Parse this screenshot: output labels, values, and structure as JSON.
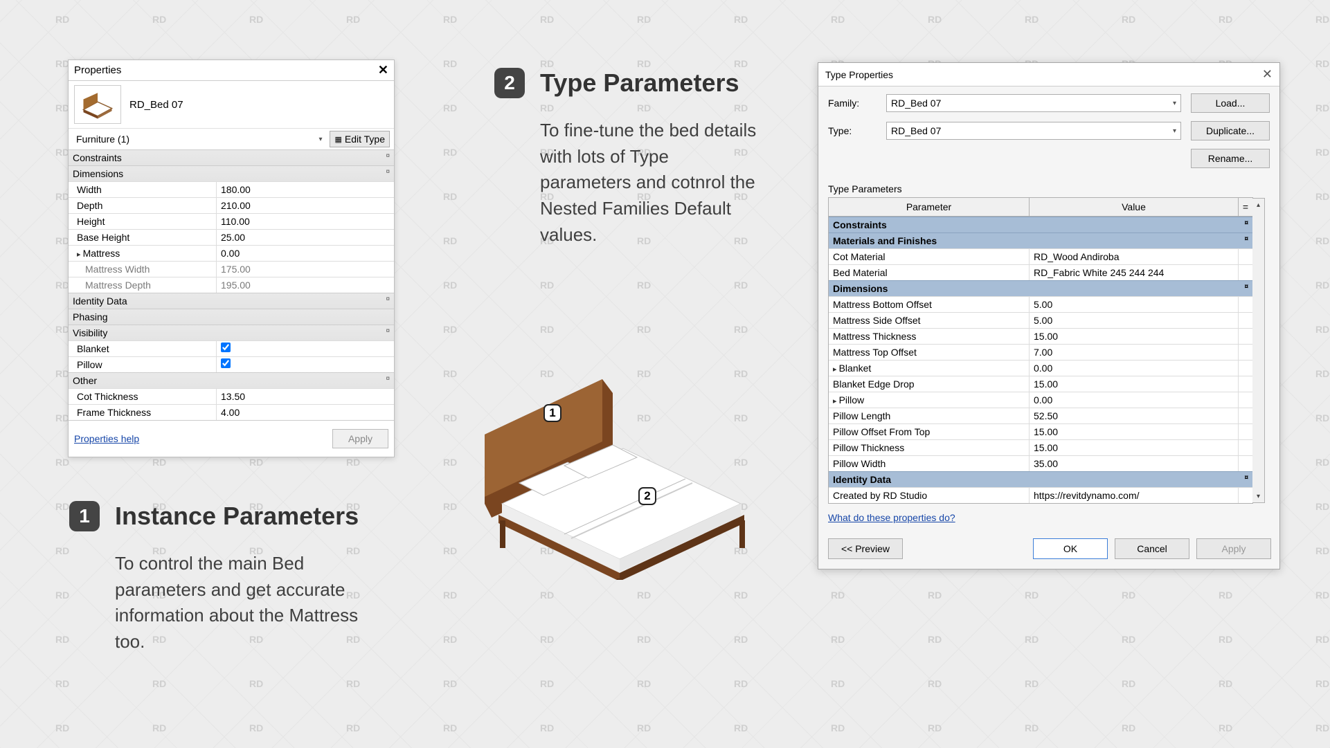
{
  "props": {
    "title": "Properties",
    "item_name": "RD_Bed 07",
    "filter": "Furniture (1)",
    "edit_type": "Edit Type",
    "groups": {
      "constraints": "Constraints",
      "dimensions": "Dimensions",
      "identity": "Identity Data",
      "phasing": "Phasing",
      "visibility": "Visibility",
      "other": "Other"
    },
    "dims": {
      "width": {
        "name": "Width",
        "value": "180.00"
      },
      "depth": {
        "name": "Depth",
        "value": "210.00"
      },
      "height": {
        "name": "Height",
        "value": "110.00"
      },
      "base_height": {
        "name": "Base Height",
        "value": "25.00"
      },
      "mattress": {
        "name": "Mattress",
        "value": "0.00"
      },
      "mattress_width": {
        "name": "Mattress Width",
        "value": "175.00"
      },
      "mattress_depth": {
        "name": "Mattress Depth",
        "value": "195.00"
      }
    },
    "vis": {
      "blanket": "Blanket",
      "pillow": "Pillow"
    },
    "other": {
      "cot_thickness": {
        "name": "Cot Thickness",
        "value": "13.50"
      },
      "frame_thickness": {
        "name": "Frame Thickness",
        "value": "4.00"
      }
    },
    "help": "Properties help",
    "apply": "Apply"
  },
  "callout1": {
    "badge": "1",
    "title": "Instance Parameters",
    "body": "To control the main Bed parameters and get accurate information about the Mattress too."
  },
  "callout2": {
    "badge": "2",
    "title": "Type Parameters",
    "body": "To fine-tune the bed details with lots of Type parameters and cotnrol the Nested Families Default values."
  },
  "bed": {
    "badge1": "1",
    "badge2": "2"
  },
  "type": {
    "title": "Type Properties",
    "family_label": "Family:",
    "type_label": "Type:",
    "family_value": "RD_Bed 07",
    "type_value": "RD_Bed 07",
    "btn_load": "Load...",
    "btn_duplicate": "Duplicate...",
    "btn_rename": "Rename...",
    "section": "Type Parameters",
    "col_param": "Parameter",
    "col_value": "Value",
    "col_eq": "=",
    "groups": {
      "constraints": "Constraints",
      "materials": "Materials and Finishes",
      "dimensions": "Dimensions",
      "identity": "Identity Data"
    },
    "materials": {
      "cot": {
        "name": "Cot Material",
        "value": "RD_Wood Andiroba"
      },
      "bed": {
        "name": "Bed Material",
        "value": "RD_Fabric White 245 244 244"
      }
    },
    "dims": {
      "m_bottom": {
        "name": "Mattress Bottom Offset",
        "value": "5.00"
      },
      "m_side": {
        "name": "Mattress Side Offset",
        "value": "5.00"
      },
      "m_thick": {
        "name": "Mattress Thickness",
        "value": "15.00"
      },
      "m_top": {
        "name": "Mattress Top Offset",
        "value": "7.00"
      },
      "blanket": {
        "name": "Blanket",
        "value": "0.00"
      },
      "b_edge": {
        "name": "Blanket Edge Drop",
        "value": "15.00"
      },
      "pillow": {
        "name": "Pillow",
        "value": "0.00"
      },
      "p_len": {
        "name": "Pillow Length",
        "value": "52.50"
      },
      "p_off": {
        "name": "Pillow Offset From Top",
        "value": "15.00"
      },
      "p_thick": {
        "name": "Pillow Thickness",
        "value": "15.00"
      },
      "p_width": {
        "name": "Pillow Width",
        "value": "35.00"
      }
    },
    "identity": {
      "created": {
        "name": "Created by RD Studio",
        "value": "https://revitdynamo.com/"
      }
    },
    "link": "What do these properties do?",
    "btn_preview": "<< Preview",
    "btn_ok": "OK",
    "btn_cancel": "Cancel",
    "btn_apply": "Apply"
  },
  "watermark": "RD"
}
